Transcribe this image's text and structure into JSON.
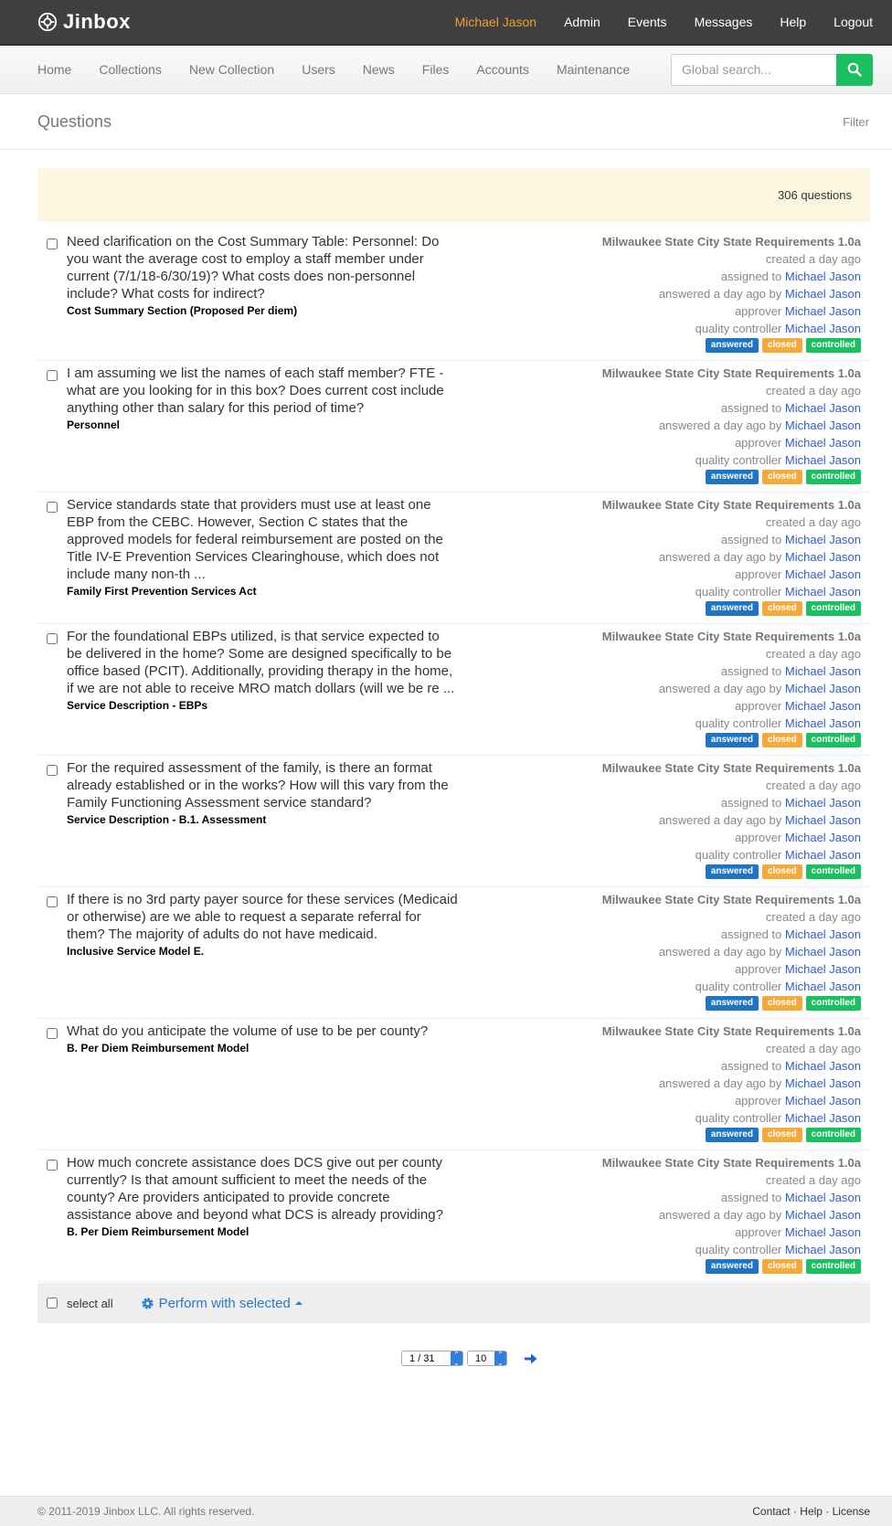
{
  "brand": {
    "name": "Jinbox",
    "logo_icon": "jinbox-logo-icon"
  },
  "topnav": [
    "Michael Jason",
    "Admin",
    "Events",
    "Messages",
    "Help",
    "Logout"
  ],
  "subnav": [
    "Home",
    "Collections",
    "New Collection",
    "Users",
    "News",
    "Files",
    "Accounts",
    "Maintenance"
  ],
  "search": {
    "placeholder": "Global search...",
    "icon": "search-icon"
  },
  "page": {
    "title": "Questions",
    "filter_label": "Filter"
  },
  "summary": {
    "count_label": "306 questions"
  },
  "labels": {
    "created": "created a day ago",
    "assigned_prefix": "assigned to",
    "answered_prefix": "answered a day ago by",
    "approver_prefix": "approver",
    "qc_prefix": "quality controller",
    "badge_answered": "answered",
    "badge_closed": "closed",
    "badge_controlled": "controlled"
  },
  "colors": {
    "answered": "#1f74c4",
    "closed": "#f5ab3b",
    "controlled": "#1cbf5f",
    "accent": "#f0a030",
    "link": "#3060c0"
  },
  "questions": [
    {
      "text": "Need clarification on the Cost Summary Table: Personnel: Do you want the average cost to employ a staff member under current (7/1/18-6/30/19)? What costs does non-personnel include? What costs for indirect?",
      "section": "Cost Summary Section (Proposed Per diem)",
      "collection": "Milwaukee State City State Requirements 1.0a",
      "assigned": "Michael Jason",
      "answered_by": "Michael Jason",
      "approver": "Michael Jason",
      "qc": "Michael Jason"
    },
    {
      "text": "I am assuming we list the names of each staff member? FTE - what are you looking for in this box? Does current cost include anything other than salary for this period of time?",
      "section": "Personnel",
      "collection": "Milwaukee State City State Requirements 1.0a",
      "assigned": "Michael Jason",
      "answered_by": "Michael Jason",
      "approver": "Michael Jason",
      "qc": "Michael Jason"
    },
    {
      "text": "Service standards state that providers must use at least one EBP from the CEBC. However, Section C states that the approved models for federal reimbursement are posted on the Title IV-E Prevention Services Clearinghouse, which does not include many non-th ...",
      "section": "Family First Prevention Services Act",
      "collection": "Milwaukee State City State Requirements 1.0a",
      "assigned": "Michael Jason",
      "answered_by": "Michael Jason",
      "approver": "Michael Jason",
      "qc": "Michael Jason"
    },
    {
      "text": "For the foundational EBPs utilized, is that service expected to be delivered in the home? Some are designed specifically to be office based (PCIT). Additionally, providing therapy in the home, if we are not able to receive MRO match dollars (will we be re ...",
      "section": "Service Description - EBPs",
      "collection": "Milwaukee State City State Requirements 1.0a",
      "assigned": "Michael Jason",
      "answered_by": "Michael Jason",
      "approver": "Michael Jason",
      "qc": "Michael Jason"
    },
    {
      "text": "For the required assessment of the family, is there an format already established or in the works? How will this vary from the Family Functioning Assessment service standard?",
      "section": "Service Description - B.1. Assessment",
      "collection": "Milwaukee State City State Requirements 1.0a",
      "assigned": "Michael Jason",
      "answered_by": "Michael Jason",
      "approver": "Michael Jason",
      "qc": "Michael Jason"
    },
    {
      "text": "If there is no 3rd party payer source for these services (Medicaid or otherwise) are we able to request a separate referral for them? The majority of adults do not have medicaid.",
      "section": "Inclusive Service Model E.",
      "collection": "Milwaukee State City State Requirements 1.0a",
      "assigned": "Michael Jason",
      "answered_by": "Michael Jason",
      "approver": "Michael Jason",
      "qc": "Michael Jason"
    },
    {
      "text": "What do you anticipate the volume of use to be per county?",
      "section": "B. Per Diem Reimbursement Model",
      "collection": "Milwaukee State City State Requirements 1.0a",
      "assigned": "Michael Jason",
      "answered_by": "Michael Jason",
      "approver": "Michael Jason",
      "qc": "Michael Jason"
    },
    {
      "text": "How much concrete assistance does DCS give out per county currently? Is that amount sufficient to meet the needs of the county? Are providers anticipated to provide concrete assistance above and beyond what DCS is already providing?",
      "section": "B. Per Diem Reimbursement Model",
      "collection": "Milwaukee State City State Requirements 1.0a",
      "assigned": "Michael Jason",
      "answered_by": "Michael Jason",
      "approver": "Michael Jason",
      "qc": "Michael Jason"
    }
  ],
  "bulk": {
    "select_all": "select all",
    "perform": "Perform with selected",
    "icon": "gear-icon"
  },
  "pager": {
    "page": "1 / 31",
    "per_page": "10",
    "next_icon": "arrow-right-icon"
  },
  "footer": {
    "copyright": "© 2011-2019 Jinbox LLC. All rights reserved.",
    "links": "Contact · Help · License"
  }
}
